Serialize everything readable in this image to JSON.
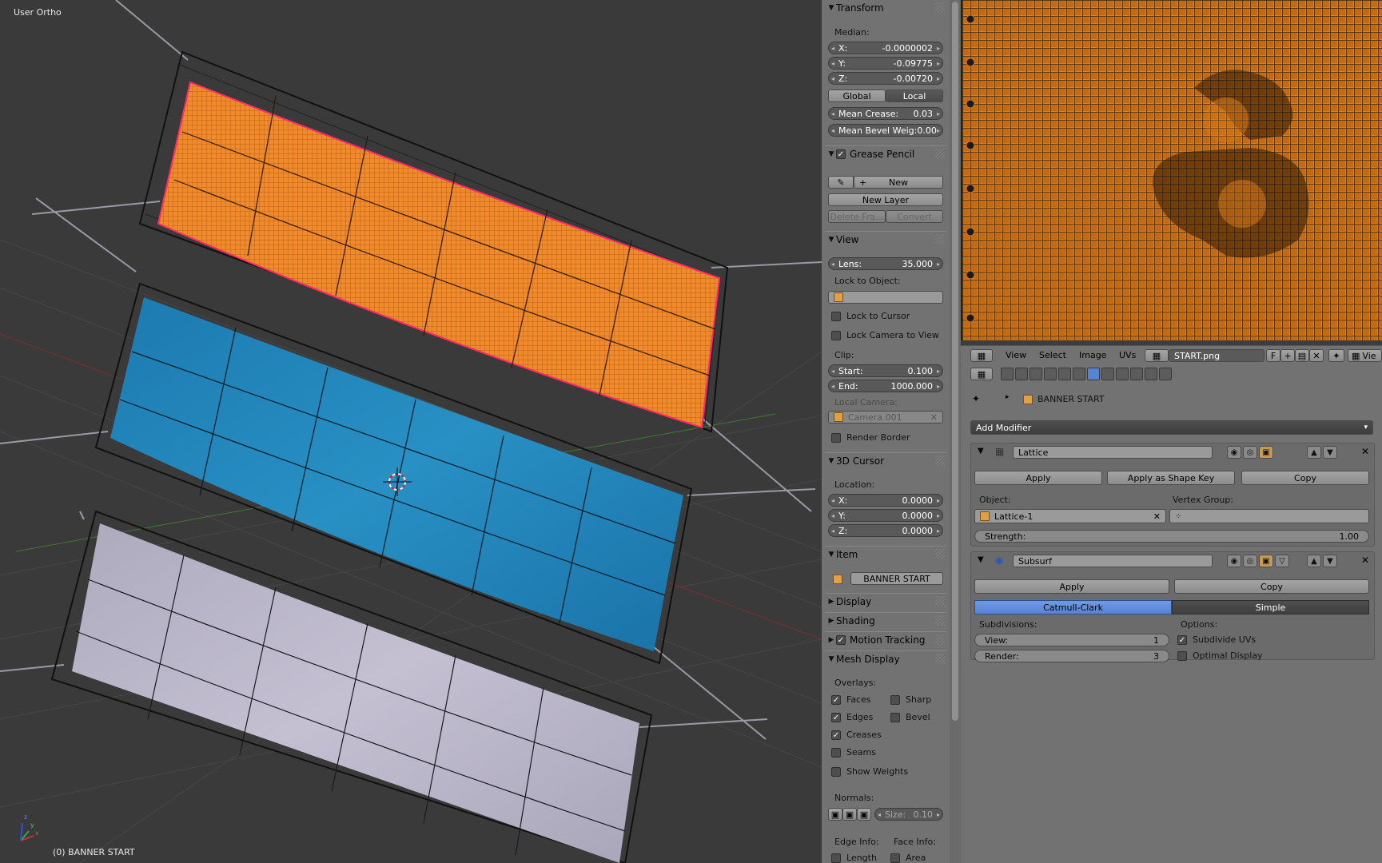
{
  "viewport": {
    "view_label": "User Ortho",
    "object_label": "(0) BANNER START",
    "axis_labels": {
      "x": "x",
      "y": "y",
      "z": "z"
    }
  },
  "npanel": {
    "transform": {
      "title": "Transform",
      "median_label": "Median:",
      "x": {
        "label": "X:",
        "value": "-0.0000002"
      },
      "y": {
        "label": "Y:",
        "value": "-0.09775"
      },
      "z": {
        "label": "Z:",
        "value": "-0.00720"
      },
      "global": "Global",
      "local": "Local",
      "mean_crease": {
        "label": "Mean Crease:",
        "value": "0.03"
      },
      "mean_bevel": {
        "label": "Mean Bevel Weig:",
        "value": "0.00"
      }
    },
    "grease_pencil": {
      "title": "Grease Pencil",
      "new": "New",
      "new_layer": "New Layer",
      "delete_frame": "Delete Fra...",
      "convert": "Convert"
    },
    "view": {
      "title": "View",
      "lens": {
        "label": "Lens:",
        "value": "35.000"
      },
      "lock_to_object": "Lock to Object:",
      "lock_to_cursor": "Lock to Cursor",
      "lock_camera": "Lock Camera to View",
      "clip_label": "Clip:",
      "start": {
        "label": "Start:",
        "value": "0.100"
      },
      "end": {
        "label": "End:",
        "value": "1000.000"
      },
      "local_camera_label": "Local Camera:",
      "local_camera": "Camera.001",
      "render_border": "Render Border"
    },
    "cursor": {
      "title": "3D Cursor",
      "location_label": "Location:",
      "x": {
        "label": "X:",
        "value": "0.0000"
      },
      "y": {
        "label": "Y:",
        "value": "0.0000"
      },
      "z": {
        "label": "Z:",
        "value": "0.0000"
      }
    },
    "item": {
      "title": "Item",
      "name": "BANNER START"
    },
    "display": {
      "title": "Display"
    },
    "shading": {
      "title": "Shading"
    },
    "motion_tracking": {
      "title": "Motion Tracking"
    },
    "mesh_display": {
      "title": "Mesh Display",
      "overlays_label": "Overlays:",
      "faces": "Faces",
      "sharp": "Sharp",
      "edges": "Edges",
      "bevel": "Bevel",
      "creases": "Creases",
      "seams": "Seams",
      "show_weights": "Show Weights",
      "normals_label": "Normals:",
      "size": {
        "label": "Size:",
        "value": "0.10"
      },
      "edge_info": "Edge Info:",
      "face_info": "Face Info:",
      "length": "Length",
      "area": "Area"
    }
  },
  "image_editor": {
    "menus": {
      "view": "View",
      "select": "Select",
      "image": "Image",
      "uvs": "UVs"
    },
    "image_name": "START.png",
    "f_label": "F",
    "vie_label": "Vie"
  },
  "properties": {
    "object_name": "BANNER START",
    "add_modifier": "Add Modifier",
    "lattice": {
      "name": "Lattice",
      "apply": "Apply",
      "apply_shape": "Apply as Shape Key",
      "copy": "Copy",
      "object_label": "Object:",
      "object_value": "Lattice-1",
      "vertex_group_label": "Vertex Group:",
      "strength": {
        "label": "Strength:",
        "value": "1.00"
      }
    },
    "subsurf": {
      "name": "Subsurf",
      "apply": "Apply",
      "copy": "Copy",
      "catmull": "Catmull-Clark",
      "simple": "Simple",
      "subdivisions_label": "Subdivisions:",
      "options_label": "Options:",
      "view": {
        "label": "View:",
        "value": "1"
      },
      "render": {
        "label": "Render:",
        "value": "3"
      },
      "subdivide_uvs": "Subdivide UVs",
      "optimal_display": "Optimal Display"
    }
  },
  "colors": {
    "orange_banner": "#f08a2a",
    "blue_banner": "#2286b8",
    "white_banner": "#b8b4c8",
    "selection_outline": "#ff2a6a",
    "active_blue": "#5683d4"
  }
}
